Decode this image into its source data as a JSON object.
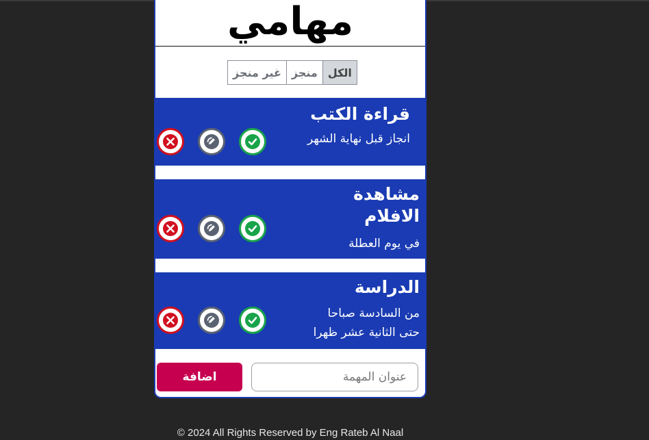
{
  "app": {
    "title": "مهامي"
  },
  "filters": [
    {
      "label": "الكل",
      "active": true
    },
    {
      "label": "منجز",
      "active": false
    },
    {
      "label": "غير منجز",
      "active": false
    }
  ],
  "tasks": [
    {
      "title": "قراءة الكتب",
      "details": [
        "انجاز قبل نهاية الشهر"
      ]
    },
    {
      "title_lines": [
        "مشاهدة",
        "الافلام"
      ],
      "details": [
        "في يوم العطلة"
      ]
    },
    {
      "title": "الدراسة",
      "details": [
        "من السادسة صباحا",
        "حتى الثانية عشر ظهرا"
      ]
    }
  ],
  "add_form": {
    "placeholder": "عنوان المهمة",
    "button_label": "اضافة"
  },
  "footer": {
    "text": "© 2024 All Rights Reserved by Eng Rateb Al Naal"
  },
  "colors": {
    "task_bg": "#1a3bb3",
    "delete": "#d20f1f",
    "edit": "#5b6272",
    "done": "#19a34a",
    "add_button": "#c6004f"
  },
  "icons": {
    "delete": "x-circle-icon",
    "edit": "pencil-circle-icon",
    "done": "check-circle-icon"
  }
}
